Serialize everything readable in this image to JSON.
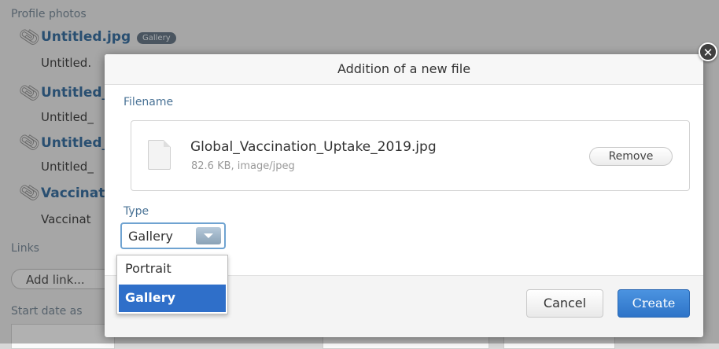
{
  "background": {
    "section_profile_photos": "Profile photos",
    "attachments": [
      {
        "title": "Untitled.jpg",
        "badge": "Gallery",
        "subtitle": "Untitled."
      },
      {
        "title": "Untitled_",
        "subtitle": "Untitled_"
      },
      {
        "title": "Untitled_",
        "subtitle": "Untitled_"
      },
      {
        "title": "Vaccinat",
        "subtitle": "Vaccinat"
      }
    ],
    "section_links": "Links",
    "add_link_label": "Add link...",
    "start_date_label": "Start date as"
  },
  "modal": {
    "title": "Addition of a new file",
    "close_icon": "close-icon",
    "filename_label": "Filename",
    "file": {
      "name": "Global_Vaccination_Uptake_2019.jpg",
      "meta": "82.6 KB, image/jpeg",
      "icon": "document-icon",
      "remove_label": "Remove"
    },
    "type_label": "Type",
    "type_select": {
      "selected": "Gallery",
      "options": [
        "Portrait",
        "Gallery"
      ]
    },
    "cancel_label": "Cancel",
    "create_label": "Create"
  },
  "colors": {
    "link_blue": "#2a6498",
    "primary_button": "#2e74c8",
    "selected_option": "#2f6fc9",
    "label_blue": "#4a7396"
  }
}
